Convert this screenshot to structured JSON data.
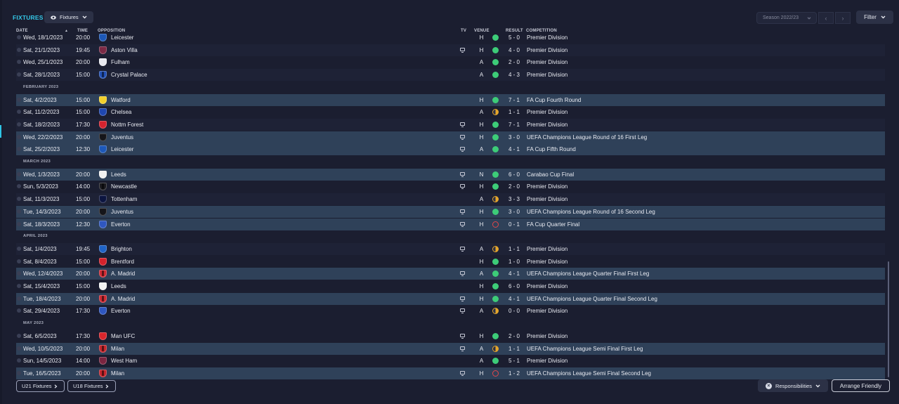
{
  "header": {
    "title": "FIXTURES",
    "view_label": "Fixtures",
    "season_label": "Season 2022/23",
    "filter_label": "Filter"
  },
  "columns": {
    "date": "DATE",
    "time": "TIME",
    "opposition": "OPPOSITION",
    "tv": "TV",
    "venue": "VENUE",
    "result": "RESULT",
    "competition": "COMPETITION"
  },
  "rows": [
    {
      "type": "match",
      "date": "Wed, 18/1/2023",
      "time": "20:00",
      "opp": "Leicester",
      "badge": "#1d58b8",
      "stripe": false,
      "tv": false,
      "venue": "H",
      "outcome": "win",
      "result": "5 - 0",
      "comp": "Premier Division",
      "hl": false
    },
    {
      "type": "match",
      "date": "Sat, 21/1/2023",
      "time": "19:45",
      "opp": "Aston Villa",
      "badge": "#7b2a45",
      "stripe": false,
      "tv": true,
      "venue": "H",
      "outcome": "win",
      "result": "4 - 0",
      "comp": "Premier Division",
      "hl": false
    },
    {
      "type": "match",
      "date": "Wed, 25/1/2023",
      "time": "20:00",
      "opp": "Fulham",
      "badge": "#e8e8ee",
      "stripe": false,
      "tv": false,
      "venue": "A",
      "outcome": "win",
      "result": "2 - 0",
      "comp": "Premier Division",
      "hl": false
    },
    {
      "type": "match",
      "date": "Sat, 28/1/2023",
      "time": "15:00",
      "opp": "Crystal Palace",
      "badge": "#2251b5",
      "stripe": true,
      "tv": false,
      "venue": "A",
      "outcome": "win",
      "result": "4 - 3",
      "comp": "Premier Division",
      "hl": false
    },
    {
      "type": "month",
      "label": "FEBRUARY 2023"
    },
    {
      "type": "match",
      "date": "Sat, 4/2/2023",
      "time": "15:00",
      "opp": "Watford",
      "badge": "#f2d02c",
      "stripe": false,
      "tv": false,
      "venue": "H",
      "outcome": "win",
      "result": "7 - 1",
      "comp": "FA Cup Fourth Round",
      "hl": true
    },
    {
      "type": "match",
      "date": "Sat, 11/2/2023",
      "time": "15:00",
      "opp": "Chelsea",
      "badge": "#1f47b0",
      "stripe": false,
      "tv": false,
      "venue": "A",
      "outcome": "draw",
      "result": "1 - 1",
      "comp": "Premier Division",
      "hl": false
    },
    {
      "type": "match",
      "date": "Sat, 18/2/2023",
      "time": "17:30",
      "opp": "Nottm Forest",
      "badge": "#d4232f",
      "stripe": false,
      "tv": true,
      "venue": "H",
      "outcome": "win",
      "result": "7 - 1",
      "comp": "Premier Division",
      "hl": false
    },
    {
      "type": "match",
      "date": "Wed, 22/2/2023",
      "time": "20:00",
      "opp": "Juventus",
      "badge": "#15151a",
      "stripe": false,
      "tv": true,
      "venue": "H",
      "outcome": "win",
      "result": "3 - 0",
      "comp": "UEFA Champions League Round of 16  First Leg",
      "hl": true
    },
    {
      "type": "match",
      "date": "Sat, 25/2/2023",
      "time": "12:30",
      "opp": "Leicester",
      "badge": "#1d58b8",
      "stripe": false,
      "tv": true,
      "venue": "A",
      "outcome": "win",
      "result": "4 - 1",
      "comp": "FA Cup Fifth Round",
      "hl": true
    },
    {
      "type": "month",
      "label": "MARCH 2023"
    },
    {
      "type": "match",
      "date": "Wed, 1/3/2023",
      "time": "20:00",
      "opp": "Leeds",
      "badge": "#f2f2f2",
      "stripe": false,
      "tv": true,
      "venue": "N",
      "outcome": "win",
      "result": "6 - 0",
      "comp": "Carabao Cup Final",
      "hl": true
    },
    {
      "type": "match",
      "date": "Sun, 5/3/2023",
      "time": "14:00",
      "opp": "Newcastle",
      "badge": "#1a1a1f",
      "stripe": true,
      "tv": true,
      "venue": "H",
      "outcome": "win",
      "result": "2 - 0",
      "comp": "Premier Division",
      "hl": false
    },
    {
      "type": "match",
      "date": "Sat, 11/3/2023",
      "time": "15:00",
      "opp": "Tottenham",
      "badge": "#0c1540",
      "stripe": false,
      "tv": false,
      "venue": "A",
      "outcome": "draw",
      "result": "3 - 3",
      "comp": "Premier Division",
      "hl": false
    },
    {
      "type": "match",
      "date": "Tue, 14/3/2023",
      "time": "20:00",
      "opp": "Juventus",
      "badge": "#15151a",
      "stripe": false,
      "tv": true,
      "venue": "H",
      "outcome": "win",
      "result": "3 - 0",
      "comp": "UEFA Champions League Round of 16  Second Leg",
      "hl": true
    },
    {
      "type": "match",
      "date": "Sat, 18/3/2023",
      "time": "12:30",
      "opp": "Everton",
      "badge": "#2f57c0",
      "stripe": false,
      "tv": true,
      "venue": "H",
      "outcome": "loss",
      "result": "0 - 1",
      "comp": "FA Cup Quarter Final",
      "hl": true
    },
    {
      "type": "month",
      "label": "APRIL 2023"
    },
    {
      "type": "match",
      "date": "Sat, 1/4/2023",
      "time": "19:45",
      "opp": "Brighton",
      "badge": "#1f63c6",
      "stripe": false,
      "tv": true,
      "venue": "A",
      "outcome": "draw",
      "result": "1 - 1",
      "comp": "Premier Division",
      "hl": false
    },
    {
      "type": "match",
      "date": "Sat, 8/4/2023",
      "time": "15:00",
      "opp": "Brentford",
      "badge": "#d4222b",
      "stripe": false,
      "tv": false,
      "venue": "H",
      "outcome": "win",
      "result": "1 - 0",
      "comp": "Premier Division",
      "hl": false
    },
    {
      "type": "match",
      "date": "Wed, 12/4/2023",
      "time": "20:00",
      "opp": "A. Madrid",
      "badge": "#cf2a33",
      "stripe": true,
      "tv": true,
      "venue": "A",
      "outcome": "win",
      "result": "4 - 1",
      "comp": "UEFA Champions League Quarter Final First Leg",
      "hl": true
    },
    {
      "type": "match",
      "date": "Sat, 15/4/2023",
      "time": "15:00",
      "opp": "Leeds",
      "badge": "#f2f2f2",
      "stripe": false,
      "tv": false,
      "venue": "H",
      "outcome": "win",
      "result": "6 - 0",
      "comp": "Premier Division",
      "hl": false
    },
    {
      "type": "match",
      "date": "Tue, 18/4/2023",
      "time": "20:00",
      "opp": "A. Madrid",
      "badge": "#cf2a33",
      "stripe": true,
      "tv": true,
      "venue": "H",
      "outcome": "win",
      "result": "4 - 1",
      "comp": "UEFA Champions League Quarter Final Second Leg",
      "hl": true
    },
    {
      "type": "match",
      "date": "Sat, 29/4/2023",
      "time": "17:30",
      "opp": "Everton",
      "badge": "#2f57c0",
      "stripe": false,
      "tv": true,
      "venue": "A",
      "outcome": "draw",
      "result": "0 - 0",
      "comp": "Premier Division",
      "hl": false
    },
    {
      "type": "month",
      "label": "MAY 2023"
    },
    {
      "type": "match",
      "date": "Sat, 6/5/2023",
      "time": "17:30",
      "opp": "Man UFC",
      "badge": "#d8262c",
      "stripe": false,
      "tv": true,
      "venue": "H",
      "outcome": "win",
      "result": "2 - 0",
      "comp": "Premier Division",
      "hl": false
    },
    {
      "type": "match",
      "date": "Wed, 10/5/2023",
      "time": "20:00",
      "opp": "Milan",
      "badge": "#c6262d",
      "stripe": true,
      "tv": true,
      "venue": "A",
      "outcome": "draw",
      "result": "1 - 1",
      "comp": "UEFA Champions League Semi Final First Leg",
      "hl": true
    },
    {
      "type": "match",
      "date": "Sun, 14/5/2023",
      "time": "14:00",
      "opp": "West Ham",
      "badge": "#7a2540",
      "stripe": false,
      "tv": false,
      "venue": "A",
      "outcome": "win",
      "result": "5 - 1",
      "comp": "Premier Division",
      "hl": false
    },
    {
      "type": "match",
      "date": "Tue, 16/5/2023",
      "time": "20:00",
      "opp": "Milan",
      "badge": "#c6262d",
      "stripe": true,
      "tv": true,
      "venue": "H",
      "outcome": "loss",
      "result": "1 - 2",
      "comp": "UEFA Champions League Semi Final Second Leg",
      "hl": true
    }
  ],
  "footer": {
    "u21_label": "U21 Fixtures",
    "u18_label": "U18 Fixtures",
    "responsibilities_label": "Responsibilities",
    "arrange_label": "Arrange Friendly"
  }
}
